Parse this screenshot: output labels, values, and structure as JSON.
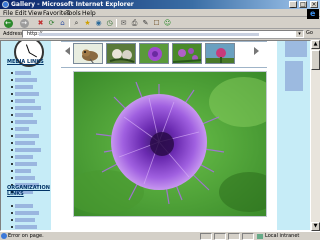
{
  "window": {
    "title": "Gallery - Microsoft Internet Explorer",
    "minimize": "_",
    "maximize": "□",
    "close": "×"
  },
  "menu": {
    "items": [
      "File",
      "Edit",
      "View",
      "Favorites",
      "Tools",
      "Help"
    ]
  },
  "toolbar": {
    "back": "←",
    "forward": "→",
    "stop": "✖",
    "refresh": "⟳",
    "home": "⌂",
    "search": "⌕",
    "favorites": "★",
    "media": "◉",
    "history": "◷",
    "mail": "✉",
    "print": "⎙",
    "edit": "✎",
    "discuss": "☐",
    "messenger": "☺"
  },
  "address": {
    "label": "Address",
    "url": "http://",
    "go": "Go",
    "dropdown": "▾"
  },
  "sidebar": {
    "media_heading": "MEDIA LINKS",
    "org_heading": "ORGANIZATION LINKS"
  },
  "statusbar": {
    "text": "Error on page.",
    "zone": "Local intranet"
  },
  "scrollbar": {
    "up": "▲",
    "down": "▼"
  }
}
